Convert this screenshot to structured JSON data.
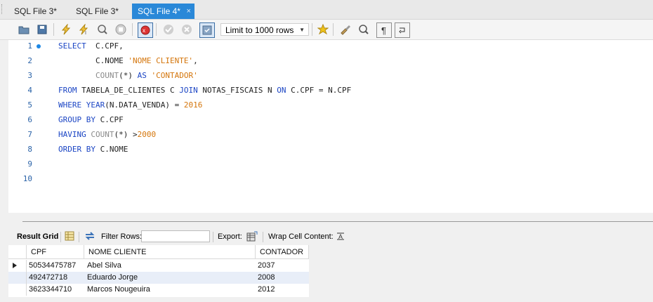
{
  "tabs": [
    {
      "label": "SQL File 3*"
    },
    {
      "label": "SQL File 3*"
    },
    {
      "label": "SQL File 4*",
      "close": "×"
    }
  ],
  "toolbar": {
    "limit_label": "Limit to 1000 rows"
  },
  "editor": {
    "line_numbers": [
      "1",
      "2",
      "3",
      "4",
      "5",
      "6",
      "7",
      "8",
      "9",
      "10"
    ],
    "lines": [
      [
        {
          "t": "kw",
          "v": "SELECT"
        },
        {
          "t": "p",
          "v": "  C.CPF,"
        }
      ],
      [
        {
          "t": "p",
          "v": "        C.NOME "
        },
        {
          "t": "str",
          "v": "'NOME CLIENTE'"
        },
        {
          "t": "p",
          "v": ","
        }
      ],
      [
        {
          "t": "p",
          "v": "        "
        },
        {
          "t": "fn",
          "v": "COUNT"
        },
        {
          "t": "p",
          "v": "(*) "
        },
        {
          "t": "kw",
          "v": "AS"
        },
        {
          "t": "p",
          "v": " "
        },
        {
          "t": "str",
          "v": "'CONTADOR'"
        }
      ],
      [
        {
          "t": "kw",
          "v": "FROM"
        },
        {
          "t": "p",
          "v": " TABELA_DE_CLIENTES C "
        },
        {
          "t": "kw",
          "v": "JOIN"
        },
        {
          "t": "p",
          "v": " NOTAS_FISCAIS N "
        },
        {
          "t": "kw",
          "v": "ON"
        },
        {
          "t": "p",
          "v": " C.CPF = N.CPF"
        }
      ],
      [
        {
          "t": "kw",
          "v": "WHERE"
        },
        {
          "t": "p",
          "v": " "
        },
        {
          "t": "kw",
          "v": "YEAR"
        },
        {
          "t": "p",
          "v": "(N.DATA_VENDA) = "
        },
        {
          "t": "num",
          "v": "2016"
        }
      ],
      [
        {
          "t": "kw",
          "v": "GROUP BY"
        },
        {
          "t": "p",
          "v": " C.CPF"
        }
      ],
      [
        {
          "t": "kw",
          "v": "HAVING"
        },
        {
          "t": "p",
          "v": " "
        },
        {
          "t": "fn",
          "v": "COUNT"
        },
        {
          "t": "p",
          "v": "(*) >"
        },
        {
          "t": "num",
          "v": "2000"
        }
      ],
      [
        {
          "t": "kw",
          "v": "ORDER BY"
        },
        {
          "t": "p",
          "v": " C.NOME"
        }
      ],
      [],
      []
    ]
  },
  "result_toolbar": {
    "result_grid": "Result Grid",
    "filter_rows": "Filter Rows:",
    "export": "Export:",
    "wrap_cell": "Wrap Cell Content:"
  },
  "grid": {
    "columns": [
      "CPF",
      "NOME CLIENTE",
      "CONTADOR"
    ],
    "rows": [
      [
        "50534475787",
        "Abel Silva",
        "2037"
      ],
      [
        "492472718",
        "Eduardo Jorge",
        "2008"
      ],
      [
        "3623344710",
        "Marcos Nougeuira",
        "2012"
      ]
    ]
  }
}
